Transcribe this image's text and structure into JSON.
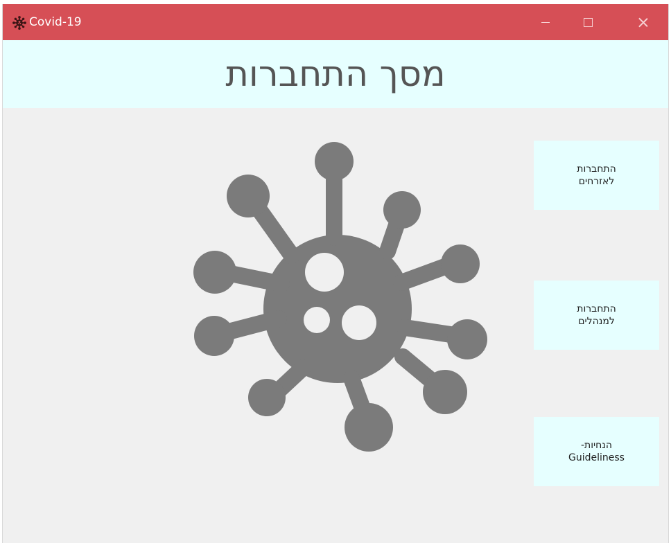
{
  "window": {
    "title": "Covid-19",
    "app_icon": "virus-icon",
    "controls": {
      "minimize": "minimize-icon",
      "maximize": "maximize-icon",
      "close": "close-icon"
    }
  },
  "header": {
    "title": "מסך התחברות"
  },
  "main": {
    "graphic": "virus-icon",
    "buttons": [
      {
        "label": "התחברות\nלאזרחים"
      },
      {
        "label": "התחברות\nלמנהלים"
      },
      {
        "label": "הנחיות-\nGuideliness"
      }
    ]
  },
  "colors": {
    "titlebar": "#d64f56",
    "header_band": "#e6ffff",
    "button_bg": "#e6ffff",
    "window_bg": "#f0f0f0",
    "virus": "#7b7b7b"
  }
}
